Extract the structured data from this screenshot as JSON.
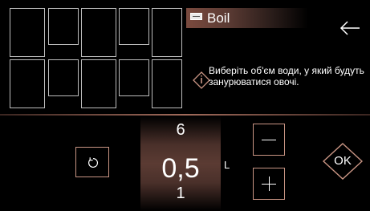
{
  "header": {
    "mode_icon": "pot-icon",
    "mode_title": "Boil",
    "back_icon": "back-arrow-icon"
  },
  "info": {
    "icon": "info-diamond-icon",
    "text": "Виберіть об'єм води, у який будуть занурюватися овочі."
  },
  "selector": {
    "value_above": "6",
    "value_current": "0,5",
    "value_below": "1",
    "unit": "L"
  },
  "controls": {
    "reset_icon": "reset-icon",
    "minus_icon": "minus-icon",
    "plus_icon": "plus-icon",
    "ok_label": "OK"
  },
  "colors": {
    "accent": "#c99584",
    "accent_dark": "#5b3b33",
    "background": "#000000"
  }
}
